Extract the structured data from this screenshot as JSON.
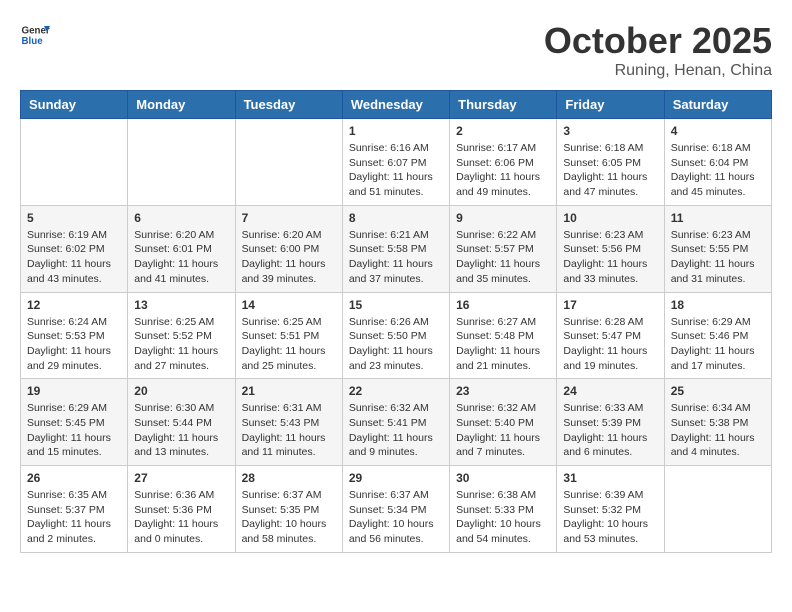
{
  "logo": {
    "general": "General",
    "blue": "Blue"
  },
  "title": "October 2025",
  "location": "Runing, Henan, China",
  "days_of_week": [
    "Sunday",
    "Monday",
    "Tuesday",
    "Wednesday",
    "Thursday",
    "Friday",
    "Saturday"
  ],
  "weeks": [
    [
      {
        "day": "",
        "info": ""
      },
      {
        "day": "",
        "info": ""
      },
      {
        "day": "",
        "info": ""
      },
      {
        "day": "1",
        "info": "Sunrise: 6:16 AM\nSunset: 6:07 PM\nDaylight: 11 hours\nand 51 minutes."
      },
      {
        "day": "2",
        "info": "Sunrise: 6:17 AM\nSunset: 6:06 PM\nDaylight: 11 hours\nand 49 minutes."
      },
      {
        "day": "3",
        "info": "Sunrise: 6:18 AM\nSunset: 6:05 PM\nDaylight: 11 hours\nand 47 minutes."
      },
      {
        "day": "4",
        "info": "Sunrise: 6:18 AM\nSunset: 6:04 PM\nDaylight: 11 hours\nand 45 minutes."
      }
    ],
    [
      {
        "day": "5",
        "info": "Sunrise: 6:19 AM\nSunset: 6:02 PM\nDaylight: 11 hours\nand 43 minutes."
      },
      {
        "day": "6",
        "info": "Sunrise: 6:20 AM\nSunset: 6:01 PM\nDaylight: 11 hours\nand 41 minutes."
      },
      {
        "day": "7",
        "info": "Sunrise: 6:20 AM\nSunset: 6:00 PM\nDaylight: 11 hours\nand 39 minutes."
      },
      {
        "day": "8",
        "info": "Sunrise: 6:21 AM\nSunset: 5:58 PM\nDaylight: 11 hours\nand 37 minutes."
      },
      {
        "day": "9",
        "info": "Sunrise: 6:22 AM\nSunset: 5:57 PM\nDaylight: 11 hours\nand 35 minutes."
      },
      {
        "day": "10",
        "info": "Sunrise: 6:23 AM\nSunset: 5:56 PM\nDaylight: 11 hours\nand 33 minutes."
      },
      {
        "day": "11",
        "info": "Sunrise: 6:23 AM\nSunset: 5:55 PM\nDaylight: 11 hours\nand 31 minutes."
      }
    ],
    [
      {
        "day": "12",
        "info": "Sunrise: 6:24 AM\nSunset: 5:53 PM\nDaylight: 11 hours\nand 29 minutes."
      },
      {
        "day": "13",
        "info": "Sunrise: 6:25 AM\nSunset: 5:52 PM\nDaylight: 11 hours\nand 27 minutes."
      },
      {
        "day": "14",
        "info": "Sunrise: 6:25 AM\nSunset: 5:51 PM\nDaylight: 11 hours\nand 25 minutes."
      },
      {
        "day": "15",
        "info": "Sunrise: 6:26 AM\nSunset: 5:50 PM\nDaylight: 11 hours\nand 23 minutes."
      },
      {
        "day": "16",
        "info": "Sunrise: 6:27 AM\nSunset: 5:48 PM\nDaylight: 11 hours\nand 21 minutes."
      },
      {
        "day": "17",
        "info": "Sunrise: 6:28 AM\nSunset: 5:47 PM\nDaylight: 11 hours\nand 19 minutes."
      },
      {
        "day": "18",
        "info": "Sunrise: 6:29 AM\nSunset: 5:46 PM\nDaylight: 11 hours\nand 17 minutes."
      }
    ],
    [
      {
        "day": "19",
        "info": "Sunrise: 6:29 AM\nSunset: 5:45 PM\nDaylight: 11 hours\nand 15 minutes."
      },
      {
        "day": "20",
        "info": "Sunrise: 6:30 AM\nSunset: 5:44 PM\nDaylight: 11 hours\nand 13 minutes."
      },
      {
        "day": "21",
        "info": "Sunrise: 6:31 AM\nSunset: 5:43 PM\nDaylight: 11 hours\nand 11 minutes."
      },
      {
        "day": "22",
        "info": "Sunrise: 6:32 AM\nSunset: 5:41 PM\nDaylight: 11 hours\nand 9 minutes."
      },
      {
        "day": "23",
        "info": "Sunrise: 6:32 AM\nSunset: 5:40 PM\nDaylight: 11 hours\nand 7 minutes."
      },
      {
        "day": "24",
        "info": "Sunrise: 6:33 AM\nSunset: 5:39 PM\nDaylight: 11 hours\nand 6 minutes."
      },
      {
        "day": "25",
        "info": "Sunrise: 6:34 AM\nSunset: 5:38 PM\nDaylight: 11 hours\nand 4 minutes."
      }
    ],
    [
      {
        "day": "26",
        "info": "Sunrise: 6:35 AM\nSunset: 5:37 PM\nDaylight: 11 hours\nand 2 minutes."
      },
      {
        "day": "27",
        "info": "Sunrise: 6:36 AM\nSunset: 5:36 PM\nDaylight: 11 hours\nand 0 minutes."
      },
      {
        "day": "28",
        "info": "Sunrise: 6:37 AM\nSunset: 5:35 PM\nDaylight: 10 hours\nand 58 minutes."
      },
      {
        "day": "29",
        "info": "Sunrise: 6:37 AM\nSunset: 5:34 PM\nDaylight: 10 hours\nand 56 minutes."
      },
      {
        "day": "30",
        "info": "Sunrise: 6:38 AM\nSunset: 5:33 PM\nDaylight: 10 hours\nand 54 minutes."
      },
      {
        "day": "31",
        "info": "Sunrise: 6:39 AM\nSunset: 5:32 PM\nDaylight: 10 hours\nand 53 minutes."
      },
      {
        "day": "",
        "info": ""
      }
    ]
  ]
}
